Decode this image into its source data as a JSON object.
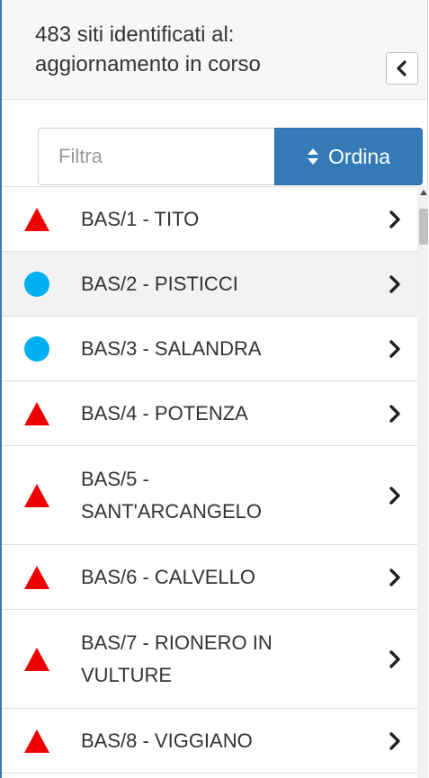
{
  "header": {
    "title": "483 siti identificati al: aggiornamento in corso",
    "collapse_icon": "chevron-left-icon"
  },
  "toolbar": {
    "filter_placeholder": "Filtra",
    "filter_value": "",
    "sort_label": "Ordina",
    "sort_icon": "sort-icon"
  },
  "colors": {
    "accent": "#337ab7",
    "triangle": "#ee0000",
    "circle": "#00b0f0"
  },
  "sites": [
    {
      "label": "BAS/1 - TITO",
      "marker": "triangle",
      "lines": 1
    },
    {
      "label": "BAS/2 - PISTICCI",
      "marker": "circle",
      "lines": 1
    },
    {
      "label": "BAS/3 - SALANDRA",
      "marker": "circle",
      "lines": 1
    },
    {
      "label": "BAS/4 - POTENZA",
      "marker": "triangle",
      "lines": 1
    },
    {
      "label": "BAS/5 - SANT'ARCANGELO",
      "marker": "triangle",
      "lines": 2
    },
    {
      "label": "BAS/6 - CALVELLO",
      "marker": "triangle",
      "lines": 1
    },
    {
      "label": "BAS/7 - RIONERO IN VULTURE",
      "marker": "triangle",
      "lines": 2
    },
    {
      "label": "BAS/8 - VIGGIANO",
      "marker": "triangle",
      "lines": 1
    }
  ]
}
